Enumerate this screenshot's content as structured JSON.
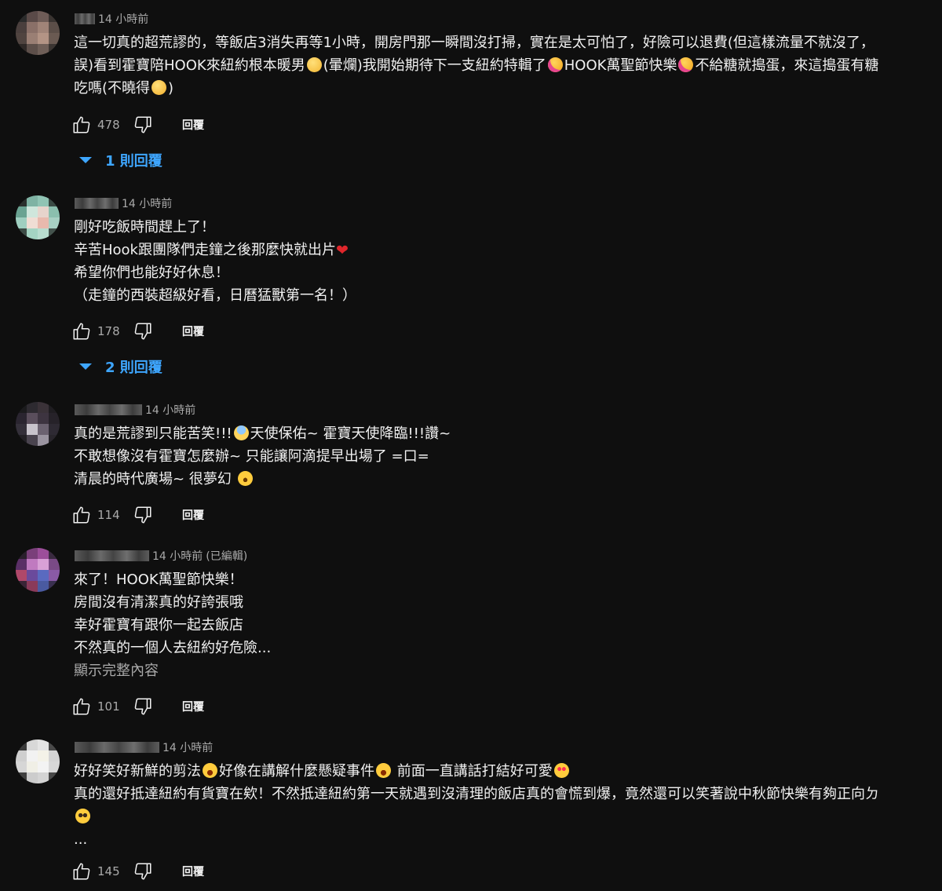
{
  "colors": {
    "background": "#0f0f0f",
    "text": "#f1f1f1",
    "secondary_text": "#aaaaaa",
    "link_blue": "#3ea6ff"
  },
  "labels": {
    "reply": "回覆",
    "show_more": "顯示完整內容"
  },
  "comments": [
    {
      "time": "14 小時前",
      "edited": "",
      "lines": [
        "這一切真的超荒謬的，等飯店3消失再等1小時，開房門那一瞬間沒打掃，實在是太可怕了，好險可以退費(但這樣流量不就沒了，",
        "誤)看到霍寶陪HOOK來紐約根本暖男",
        "(暈爛)我開始期待下一支紐約特輯了",
        "HOOK萬聖節快樂",
        "不給糖就搗蛋，來這搗蛋有糖",
        "吃嗎(不曉得",
        ")"
      ],
      "likes": "478",
      "replies_label": "1 則回覆"
    },
    {
      "time": "14 小時前",
      "edited": "",
      "lines": [
        "剛好吃飯時間趕上了！",
        "辛苦Hook跟團隊們走鐘之後那麼快就出片",
        "希望你們也能好好休息！",
        "（走鐘的西裝超級好看，日曆猛獸第一名！）"
      ],
      "likes": "178",
      "replies_label": "2 則回覆"
    },
    {
      "time": "14 小時前",
      "edited": "",
      "lines": [
        "真的是荒謬到只能苦笑!!!",
        "天使保佑~ 霍寶天使降臨!!!讚~",
        "不敢想像沒有霍寶怎麼辦~ 只能讓阿滴提早出場了 =口=",
        "清晨的時代廣場~ 很夢幻"
      ],
      "likes": "114",
      "replies_label": ""
    },
    {
      "time": "14 小時前",
      "edited": "(已編輯)",
      "lines": [
        "來了！HOOK萬聖節快樂！",
        "房間沒有清潔真的好誇張哦",
        "幸好霍寶有跟你一起去飯店",
        "不然真的一個人去紐約好危險..."
      ],
      "likes": "101",
      "replies_label": ""
    },
    {
      "time": "14 小時前",
      "edited": "",
      "lines": [
        "好好笑好新鮮的剪法",
        "好像在講解什麼懸疑事件",
        "前面一直講話打結好可愛",
        "真的還好抵達紐約有貨寶在欸！不然抵達紐約第一天就遇到沒清理的飯店真的會慌到爆，竟然還可以笑著說中秋節快樂有夠正向ㄉ",
        "..."
      ],
      "likes": "145",
      "replies_label": ""
    }
  ]
}
